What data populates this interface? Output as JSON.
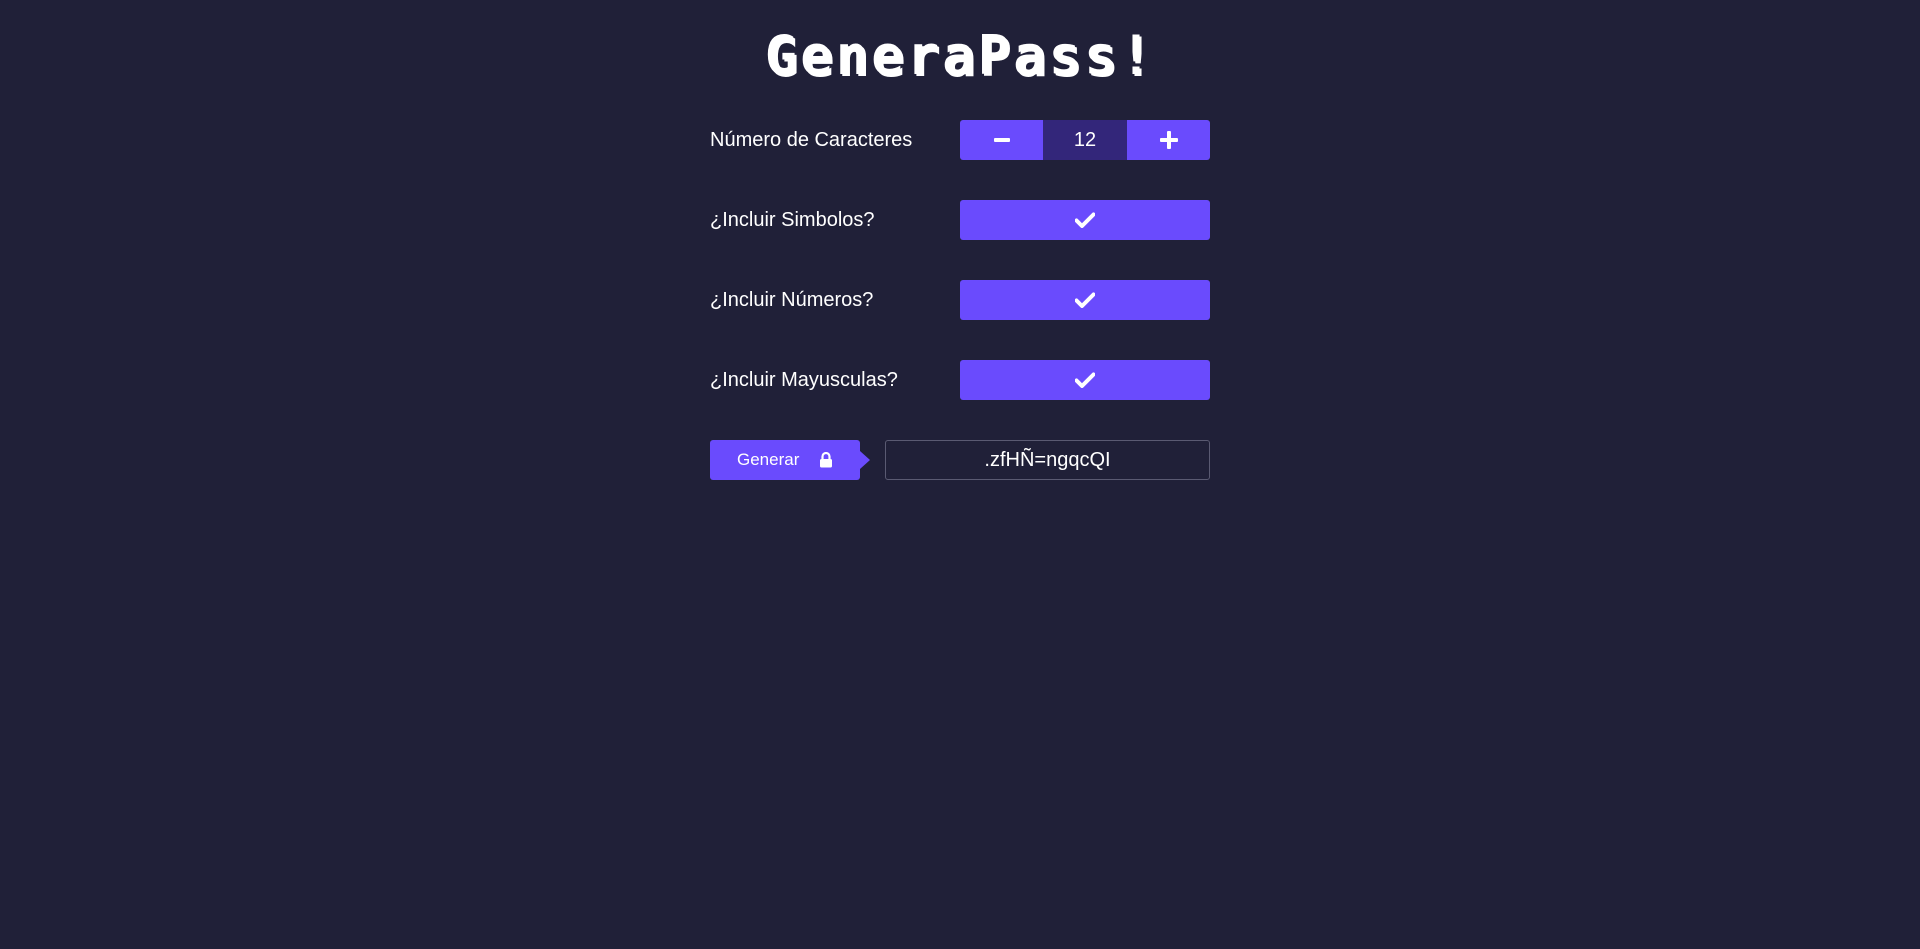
{
  "app": {
    "title": "GeneraPass!"
  },
  "options": {
    "length": {
      "label": "Número de Caracteres",
      "value": "12",
      "decrement_icon": "minus-icon",
      "increment_icon": "plus-icon"
    },
    "symbols": {
      "label": "¿Incluir Simbolos?",
      "checked": true,
      "icon": "check-icon"
    },
    "numbers": {
      "label": "¿Incluir Números?",
      "checked": true,
      "icon": "check-icon"
    },
    "uppercase": {
      "label": "¿Incluir Mayusculas?",
      "checked": true,
      "icon": "check-icon"
    }
  },
  "generate": {
    "button_label": "Generar",
    "icon": "lock-icon",
    "output_value": ".zfHÑ=ngqcQI"
  },
  "colors": {
    "background": "#202038",
    "accent": "#6a4bfd",
    "counter_bg": "#33267a",
    "text": "#ffffff"
  }
}
